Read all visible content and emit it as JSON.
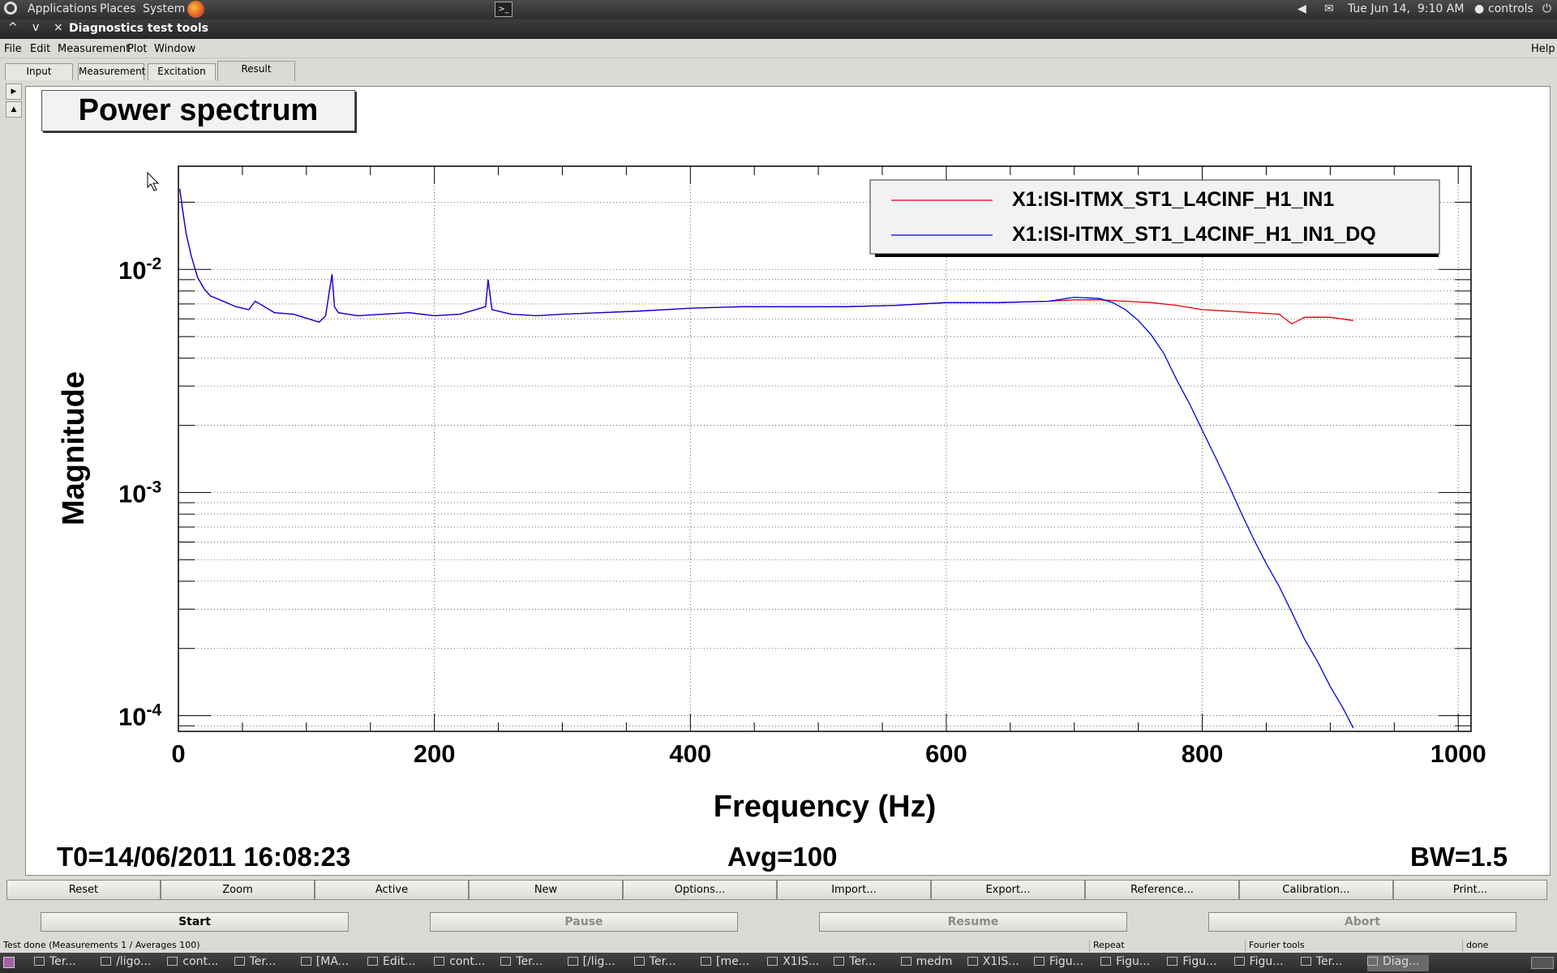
{
  "topbar": {
    "applications": "Applications",
    "places": "Places",
    "system": "System",
    "datetime": "Tue Jun 14,  9:10 AM",
    "user": "controls"
  },
  "window": {
    "title": "Diagnostics test tools",
    "ctrl_min": "^",
    "ctrl_max": "v",
    "ctrl_close": "×"
  },
  "menu": {
    "items": [
      "File",
      "Edit",
      "Measurement",
      "Plot",
      "Window"
    ],
    "help": "Help"
  },
  "tabs": [
    "Input",
    "Measurement",
    "Excitation",
    "Result"
  ],
  "selected_tab": "Result",
  "plot_title": "Power spectrum",
  "chart_data": {
    "type": "line",
    "title": "Power spectrum",
    "xlabel": "Frequency (Hz)",
    "ylabel": "Magnitude",
    "xlim": [
      0,
      1010
    ],
    "ylim": [
      8.5e-05,
      0.029
    ],
    "y_scale": "log",
    "grid": true,
    "legend_position": "top-right",
    "x_ticks": [
      "0",
      "200",
      "400",
      "600",
      "800",
      "1000"
    ],
    "y_ticks": [
      {
        "base": "10",
        "exp": "-2",
        "value": 0.01
      },
      {
        "base": "10",
        "exp": "-3",
        "value": 0.001
      },
      {
        "base": "10",
        "exp": "-4",
        "value": 0.0001
      }
    ],
    "series": [
      {
        "name": "X1:ISI-ITMX_ST1_L4CINF_H1_IN1",
        "color": "#e8000b",
        "x": [
          1,
          3,
          6,
          10,
          15,
          20,
          25,
          35,
          45,
          55,
          60,
          75,
          90,
          110,
          115,
          120,
          122,
          125,
          140,
          160,
          180,
          200,
          220,
          240,
          242,
          245,
          260,
          280,
          300,
          330,
          360,
          400,
          440,
          480,
          520,
          560,
          600,
          640,
          680,
          700,
          720,
          740,
          760,
          780,
          800,
          820,
          840,
          860,
          870,
          880,
          900,
          918
        ],
        "y": [
          0.023,
          0.019,
          0.0145,
          0.0115,
          0.0092,
          0.0082,
          0.0076,
          0.0072,
          0.0068,
          0.0066,
          0.0072,
          0.0064,
          0.0063,
          0.0058,
          0.0062,
          0.0095,
          0.0068,
          0.0064,
          0.0062,
          0.0063,
          0.0064,
          0.0062,
          0.0063,
          0.0068,
          0.009,
          0.0066,
          0.0063,
          0.0062,
          0.0063,
          0.0064,
          0.0065,
          0.0067,
          0.0068,
          0.0068,
          0.0068,
          0.0069,
          0.0071,
          0.0071,
          0.0072,
          0.0073,
          0.0073,
          0.0072,
          0.0071,
          0.0069,
          0.0066,
          0.0065,
          0.0064,
          0.0063,
          0.0057,
          0.0061,
          0.0061,
          0.0059
        ]
      },
      {
        "name": "X1:ISI-ITMX_ST1_L4CINF_H1_IN1_DQ",
        "color": "#0000e0",
        "x": [
          1,
          3,
          6,
          10,
          15,
          20,
          25,
          35,
          45,
          55,
          60,
          75,
          90,
          110,
          115,
          120,
          122,
          125,
          140,
          160,
          180,
          200,
          220,
          240,
          242,
          245,
          260,
          280,
          300,
          330,
          360,
          400,
          440,
          480,
          520,
          560,
          600,
          640,
          680,
          700,
          720,
          730,
          740,
          750,
          760,
          770,
          780,
          790,
          800,
          810,
          820,
          830,
          840,
          850,
          860,
          870,
          880,
          890,
          900,
          910,
          918
        ],
        "y": [
          0.023,
          0.019,
          0.0145,
          0.0115,
          0.0092,
          0.0082,
          0.0076,
          0.0072,
          0.0068,
          0.0066,
          0.0072,
          0.0064,
          0.0063,
          0.0058,
          0.0062,
          0.0095,
          0.0068,
          0.0064,
          0.0062,
          0.0063,
          0.0064,
          0.0062,
          0.0063,
          0.0068,
          0.009,
          0.0066,
          0.0063,
          0.0062,
          0.0063,
          0.0064,
          0.0065,
          0.0067,
          0.0068,
          0.0068,
          0.0068,
          0.0069,
          0.0071,
          0.0071,
          0.0072,
          0.0075,
          0.0074,
          0.0071,
          0.0066,
          0.0059,
          0.0051,
          0.0042,
          0.0032,
          0.0025,
          0.0019,
          0.00145,
          0.0011,
          0.00082,
          0.00062,
          0.00048,
          0.00038,
          0.00029,
          0.00022,
          0.000175,
          0.000135,
          0.000108,
          8.8e-05
        ]
      }
    ]
  },
  "footer": {
    "t0": "T0=14/06/2011 16:08:23",
    "avg": "Avg=100",
    "bw": "BW=1.5"
  },
  "buttons_row1": [
    "Reset",
    "Zoom",
    "Active",
    "New",
    "Options...",
    "Import...",
    "Export...",
    "Reference...",
    "Calibration...",
    "Print..."
  ],
  "buttons_row2": [
    {
      "label": "Start",
      "enabled": true
    },
    {
      "label": "Pause",
      "enabled": false
    },
    {
      "label": "Resume",
      "enabled": false
    },
    {
      "label": "Abort",
      "enabled": false
    }
  ],
  "status": {
    "main": "Test done (Measurements 1 / Averages 100)",
    "repeat": "Repeat",
    "tool": "Fourier tools",
    "state": "done"
  },
  "taskbar": [
    "Ter...",
    "/ligo...",
    "cont...",
    "Ter...",
    "[MA...",
    "Edit...",
    "cont...",
    "Ter...",
    "[/lig...",
    "Ter...",
    "[me...",
    "X1IS...",
    "Ter...",
    "medm",
    "X1IS...",
    "Figu...",
    "Figu...",
    "Figu...",
    "Figu...",
    "Ter...",
    "Diag..."
  ],
  "colors": {
    "series1": "#e8000b",
    "series2": "#0000e0",
    "grid": "#333333",
    "canvas": "#ffffff"
  }
}
